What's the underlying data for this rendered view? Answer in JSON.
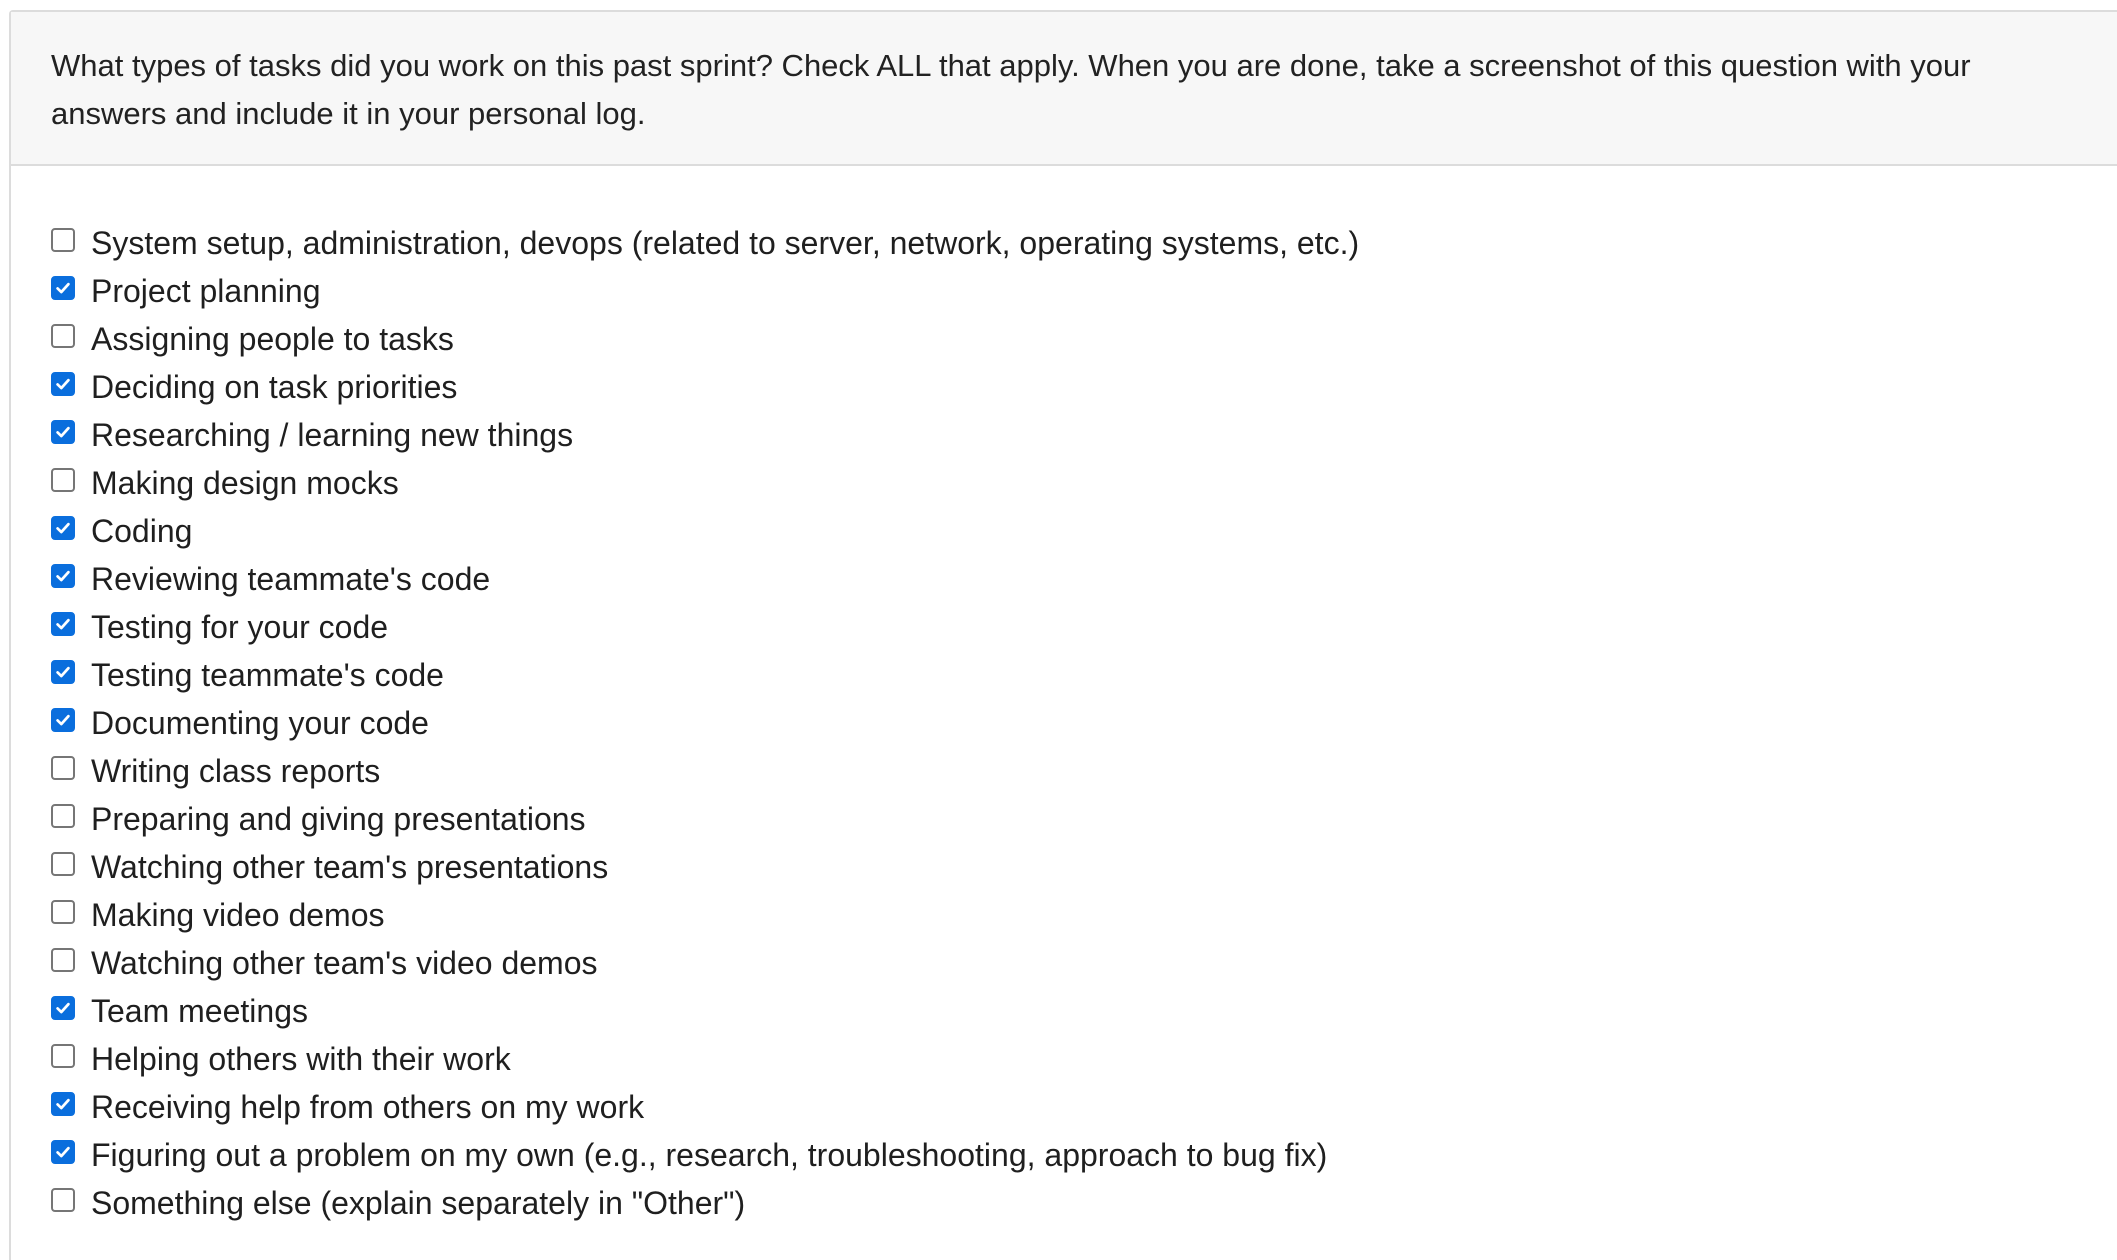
{
  "question": {
    "text": "What types of tasks did you work on this past sprint? Check ALL that apply. When you are done, take a screenshot of this question with your answers and include it in your personal log."
  },
  "colors": {
    "checked": "#0a6edd",
    "unchecked_border": "#767676",
    "header_bg": "#f7f7f7"
  },
  "options": [
    {
      "label": "System setup, administration, devops (related to server, network, operating systems, etc.)",
      "checked": false
    },
    {
      "label": "Project planning",
      "checked": true
    },
    {
      "label": "Assigning people to tasks",
      "checked": false
    },
    {
      "label": "Deciding on task priorities",
      "checked": true
    },
    {
      "label": "Researching / learning new things",
      "checked": true
    },
    {
      "label": "Making design mocks",
      "checked": false
    },
    {
      "label": "Coding",
      "checked": true
    },
    {
      "label": "Reviewing teammate's code",
      "checked": true
    },
    {
      "label": "Testing for your code",
      "checked": true
    },
    {
      "label": "Testing teammate's code",
      "checked": true
    },
    {
      "label": "Documenting your code",
      "checked": true
    },
    {
      "label": "Writing class reports",
      "checked": false
    },
    {
      "label": "Preparing and giving presentations",
      "checked": false
    },
    {
      "label": "Watching other team's presentations",
      "checked": false
    },
    {
      "label": "Making video demos",
      "checked": false
    },
    {
      "label": "Watching other team's video demos",
      "checked": false
    },
    {
      "label": "Team meetings",
      "checked": true
    },
    {
      "label": "Helping others with their work",
      "checked": false
    },
    {
      "label": "Receiving help from others on my work",
      "checked": true
    },
    {
      "label": "Figuring out a problem on my own (e.g., research, troubleshooting, approach to bug fix)",
      "checked": true
    },
    {
      "label": "Something else (explain separately in \"Other\")",
      "checked": false
    }
  ]
}
